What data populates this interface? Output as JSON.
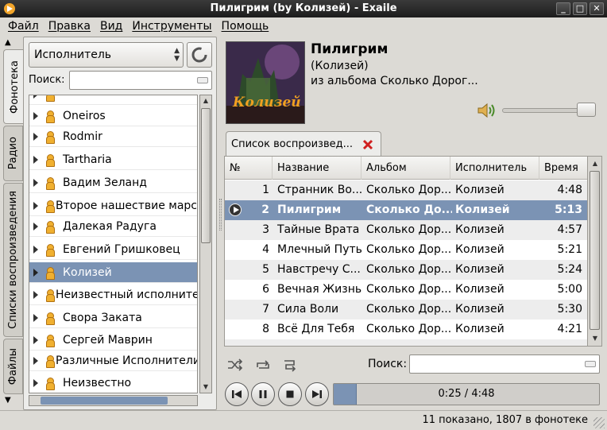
{
  "window": {
    "title": "Пилигрим (by Колизей) - Exaile",
    "buttons": [
      "_",
      "□",
      "✕"
    ]
  },
  "menu": [
    "Файл",
    "Правка",
    "Вид",
    "Инструменты",
    "Помощь"
  ],
  "side_tabs": [
    "Фонотека",
    "Радио",
    "Списки воспроизведения",
    "Файлы"
  ],
  "library": {
    "view_mode": "Исполнитель",
    "search_label": "Поиск:",
    "search_value": "",
    "items": [
      "Oneiros",
      "Rodmir",
      "Tartharia",
      "Вадим Зеланд",
      "Второе нашествие марсиан",
      "Далекая Радуга",
      "Евгений Гришковец",
      "Колизей",
      "Неизвестный исполнитель",
      "Свора Заката",
      "Сергей Маврин",
      "Различные Исполнители",
      "Неизвестно"
    ],
    "selected_index": 7
  },
  "now_playing": {
    "title": "Пилигрим",
    "artist": "(Колизей)",
    "album": "из альбома Сколько Дорог...",
    "cover_text": "Колизей",
    "volume": 0.9
  },
  "playlist": {
    "tab_label": "Список воспроизвед...",
    "columns": [
      "№",
      "Название",
      "Альбом",
      "Исполнитель",
      "Время"
    ],
    "rows": [
      {
        "num": "1",
        "title": "Странник Во...",
        "album": "Сколько Дор...",
        "artist": "Колизей",
        "time": "4:48"
      },
      {
        "num": "2",
        "title": "Пилигрим",
        "album": "Сколько До...",
        "artist": "Колизей",
        "time": "5:13"
      },
      {
        "num": "3",
        "title": "Тайные Врата",
        "album": "Сколько Дор...",
        "artist": "Колизей",
        "time": "4:57"
      },
      {
        "num": "4",
        "title": "Млечный Путь",
        "album": "Сколько Дор...",
        "artist": "Колизей",
        "time": "5:21"
      },
      {
        "num": "5",
        "title": "Навстречу С...",
        "album": "Сколько Дор...",
        "artist": "Колизей",
        "time": "5:24"
      },
      {
        "num": "6",
        "title": "Вечная Жизнь",
        "album": "Сколько Дор...",
        "artist": "Колизей",
        "time": "5:00"
      },
      {
        "num": "7",
        "title": "Сила Воли",
        "album": "Сколько Дор...",
        "artist": "Колизей",
        "time": "5:30"
      },
      {
        "num": "8",
        "title": "Всё Для Тебя",
        "album": "Сколько Дор...",
        "artist": "Колизей",
        "time": "4:21"
      }
    ],
    "playing_index": 1,
    "search_label": "Поиск:",
    "search_value": ""
  },
  "playback": {
    "position_text": "0:25 / 4:48",
    "progress": 0.087
  },
  "status": "11 показано, 1807 в фонотеке"
}
